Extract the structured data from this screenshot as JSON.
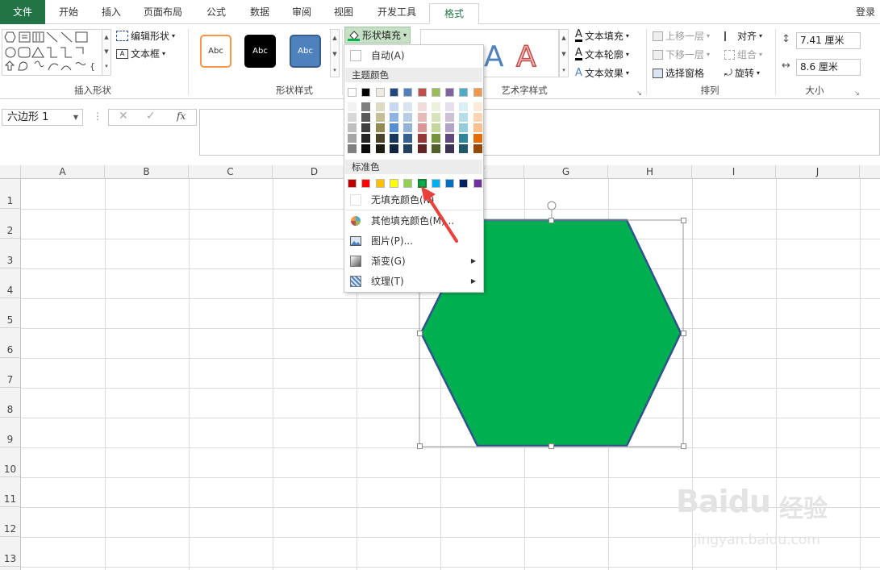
{
  "tabs": [
    "文件",
    "开始",
    "插入",
    "页面布局",
    "公式",
    "数据",
    "审阅",
    "视图",
    "开发工具",
    "格式"
  ],
  "login": "登录",
  "ribbon": {
    "insert_shapes": {
      "label": "插入形状",
      "edit_shape": "编辑形状",
      "text_box": "文本框"
    },
    "shape_styles": {
      "label": "形状样式",
      "swatch_text": "Abc"
    },
    "shape_fill": "形状填充",
    "wordart": {
      "label": "艺术字样式",
      "text_fill": "文本填充",
      "text_outline": "文本轮廓",
      "text_effects": "文本效果"
    },
    "arrange": {
      "label": "排列",
      "bring_forward": "上移一层",
      "send_backward": "下移一层",
      "selection_pane": "选择窗格",
      "align": "对齐",
      "group": "组合",
      "rotate": "旋转"
    },
    "size": {
      "label": "大小",
      "height": "7.41 厘米",
      "width": "8.6 厘米"
    }
  },
  "formula_bar": {
    "name_box": "六边形 1",
    "fx": "fx"
  },
  "columns": [
    "A",
    "B",
    "C",
    "D",
    "E",
    "F",
    "G",
    "H",
    "I",
    "J"
  ],
  "rows": [
    "1",
    "2",
    "3",
    "4",
    "5",
    "6",
    "7",
    "8",
    "9",
    "10",
    "11",
    "12",
    "13"
  ],
  "dropdown": {
    "auto": "自动(A)",
    "theme_colors": "主题颜色",
    "standard_colors": "标准色",
    "no_fill": "无填充颜色(N)",
    "more_colors": "其他填充颜色(M)...",
    "picture": "图片(P)...",
    "gradient": "渐变(G)",
    "texture": "纹理(T)"
  },
  "theme_top": [
    "#ffffff",
    "#000000",
    "#eeece1",
    "#1f497d",
    "#4f81bd",
    "#c0504d",
    "#9bbb59",
    "#8064a2",
    "#4bacc6",
    "#f79646"
  ],
  "theme_shades": [
    [
      "#f2f2f2",
      "#d8d8d8",
      "#bfbfbf",
      "#a5a5a5",
      "#7f7f7f"
    ],
    [
      "#7f7f7f",
      "#595959",
      "#3f3f3f",
      "#262626",
      "#0c0c0c"
    ],
    [
      "#ddd9c3",
      "#c4bd97",
      "#938953",
      "#494429",
      "#1d1b10"
    ],
    [
      "#c6d9f0",
      "#8db3e2",
      "#548dd4",
      "#17365d",
      "#0f243e"
    ],
    [
      "#dbe5f1",
      "#b8cce4",
      "#95b3d7",
      "#366092",
      "#244061"
    ],
    [
      "#f2dcdb",
      "#e5b9b7",
      "#d99694",
      "#953734",
      "#632423"
    ],
    [
      "#ebf1dd",
      "#d7e3bc",
      "#c3d69b",
      "#76923c",
      "#4f6128"
    ],
    [
      "#e5e0ec",
      "#ccc1d9",
      "#b2a2c7",
      "#5f497a",
      "#3f3151"
    ],
    [
      "#dbeef3",
      "#b7dde8",
      "#92cddc",
      "#31859b",
      "#205867"
    ],
    [
      "#fdeada",
      "#fbd5b5",
      "#fac08f",
      "#e36c09",
      "#974806"
    ]
  ],
  "standard": [
    "#c00000",
    "#ff0000",
    "#ffc000",
    "#ffff00",
    "#92d050",
    "#00b050",
    "#00b0f0",
    "#0070c0",
    "#002060",
    "#7030a0"
  ],
  "watermark": {
    "brand": "Baidu",
    "cn": "经验",
    "url": "jingyan.baidu.com"
  }
}
